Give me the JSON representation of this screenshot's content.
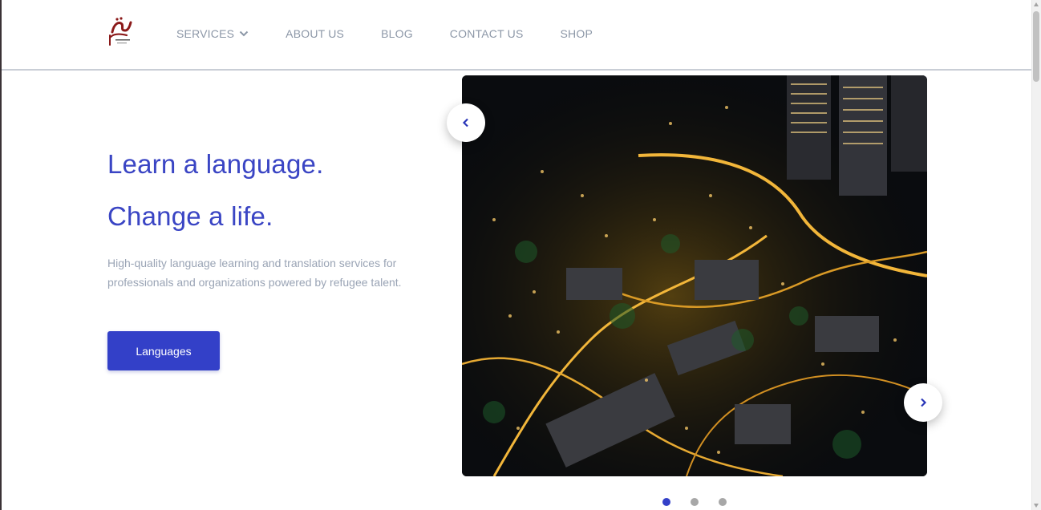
{
  "header": {
    "logo_alt": "تكلم",
    "nav": [
      {
        "label": "SERVICES",
        "has_dropdown": true
      },
      {
        "label": "ABOUT US"
      },
      {
        "label": "BLOG"
      },
      {
        "label": "CONTACT US"
      },
      {
        "label": "SHOP"
      }
    ]
  },
  "hero": {
    "line1": "Learn a language.",
    "line2": "Change a life.",
    "description": "High-quality language learning and translation services for professionals and organizations powered by refugee talent.",
    "cta_label": "Languages"
  },
  "carousel": {
    "slide_count": 3,
    "active_index": 0,
    "image_subject": "city-at-night-aerial-photo"
  },
  "colors": {
    "accent": "#3340c8",
    "headline": "#3a45c4",
    "nav_text": "#8c97a7",
    "body_text": "#9aa4b5",
    "logo_red": "#8b1a1a"
  },
  "icons": {
    "dropdown": "chevron-down-icon",
    "prev": "chevron-left-icon",
    "next": "chevron-right-icon"
  }
}
